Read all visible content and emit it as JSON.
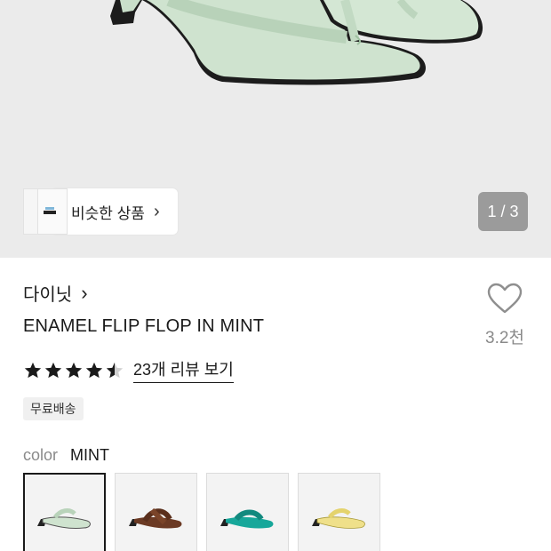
{
  "gallery": {
    "similar_label": "비슷한 상품",
    "counter": "1 / 3",
    "main_color": "#cfe3cf"
  },
  "product": {
    "brand": "다이닛",
    "name": "ENAMEL FLIP FLOP IN MINT",
    "likes": "3.2천",
    "rating": 4.5,
    "reviews_label": "23개 리뷰 보기",
    "shipping_badge": "무료배송"
  },
  "options": {
    "color_label": "color",
    "color_value": "MINT",
    "swatches": [
      {
        "name": "mint",
        "color": "#cfe3cf"
      },
      {
        "name": "brown",
        "color": "#6b3a24"
      },
      {
        "name": "teal",
        "color": "#17a79a"
      },
      {
        "name": "yellow",
        "color": "#efe08a"
      }
    ]
  }
}
